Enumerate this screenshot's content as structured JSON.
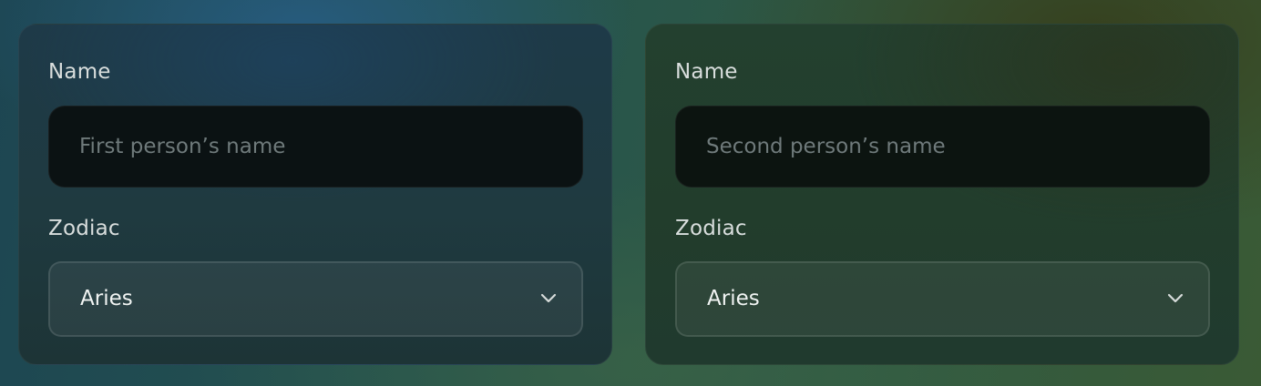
{
  "person1": {
    "name_label": "Name",
    "name_placeholder": "First person’s name",
    "name_value": "",
    "zodiac_label": "Zodiac",
    "zodiac_selected": "Aries"
  },
  "person2": {
    "name_label": "Name",
    "name_placeholder": "Second person’s name",
    "name_value": "",
    "zodiac_label": "Zodiac",
    "zodiac_selected": "Aries"
  },
  "icons": {
    "dropdown": "chevron-down-icon"
  },
  "colors": {
    "input_background": "#0b1213",
    "label_text": "#d9dedd",
    "placeholder_text": "#6f7a7b"
  }
}
